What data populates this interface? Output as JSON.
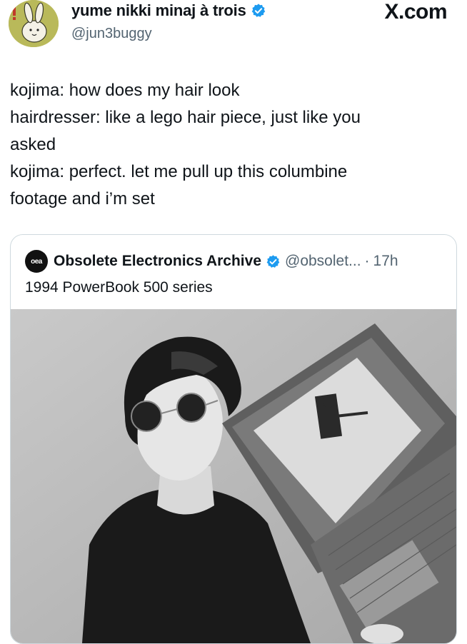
{
  "author": {
    "display_name": "yume nikki minaj à trois",
    "handle": "@jun3buggy",
    "avatar_icon": "bunny-avatar-icon",
    "verified_icon": "verified-badge-icon"
  },
  "site_logo": "X.com",
  "tweet": {
    "lines": [
      "kojima: how does my hair look",
      "hairdresser: like a lego hair piece, just like you\nasked",
      "kojima: perfect. let me pull up this columbine\nfootage and i’m set"
    ]
  },
  "quoted_tweet": {
    "logo_text": "oea",
    "display_name": "Obsolete Electronics Archive",
    "handle": "@obsolet...",
    "separator": "·",
    "time": "17h",
    "text": "1994 PowerBook 500 series",
    "media_icon": "photo-man-with-laptop-icon"
  },
  "colors": {
    "verified": "#1d9bf0",
    "secondary_text": "#536471",
    "avatar_bg": "#b9b95a"
  }
}
